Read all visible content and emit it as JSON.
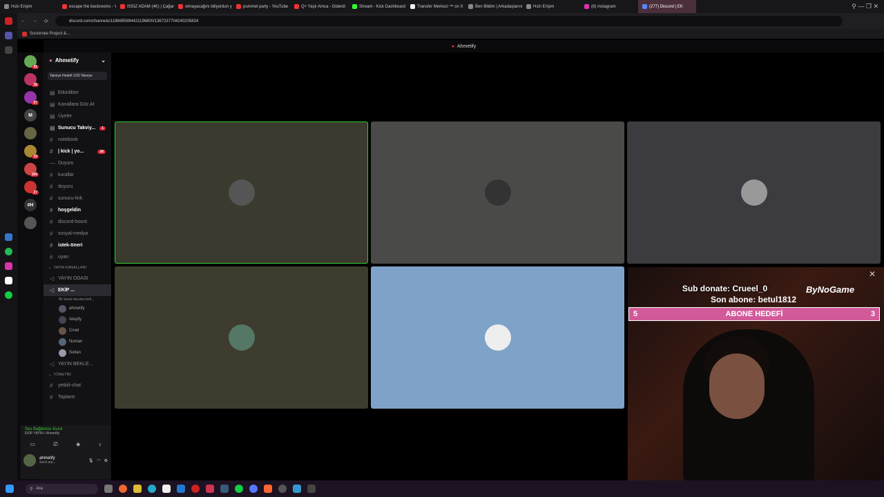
{
  "browser": {
    "tabs": [
      {
        "label": "Hızlı Erişim",
        "color": "#888"
      },
      {
        "label": "escape the backrooms - Y",
        "color": "#e33"
      },
      {
        "label": "ISSIZ ADAM (4K) | Çağan",
        "color": "#e33"
      },
      {
        "label": "olmayacağını biliyordun y",
        "color": "#e33"
      },
      {
        "label": "pummel party - YouTube",
        "color": "#e33"
      },
      {
        "label": "Q+ Yaşlı Amca - Giderdi",
        "color": "#e33"
      },
      {
        "label": "Stream - Kick Dashboard",
        "color": "#3f3"
      },
      {
        "label": "Transfer Merkezi ™ on X",
        "color": "#eee"
      },
      {
        "label": "Ben Bildim | Arkadaşlarını",
        "color": "#888"
      },
      {
        "label": "Hızlı Erişim",
        "color": "#888"
      },
      {
        "label": "(8) Instagram",
        "color": "#d3a"
      },
      {
        "label": "(277) Discord | EK",
        "color": "#58f",
        "active": true
      }
    ],
    "url": "discord.com/channels/1198695694421196800/1367237704240205834",
    "bookmark": "Sunstroke Project &..."
  },
  "discord": {
    "title": "Ahmetify",
    "server_name": "Ahmetify",
    "boost_label": "Takviye Hedefi 1/20 Takviye",
    "top_items": [
      {
        "label": "Etkinlikler"
      },
      {
        "label": "Kanallara Göz At"
      },
      {
        "label": "Üyeler"
      },
      {
        "label": "Sunucu Takviy...",
        "badge": "1",
        "bold": true
      }
    ],
    "channels_a": [
      {
        "label": "notebook",
        "prefix": "#"
      },
      {
        "label": "| kick | yo...",
        "prefix": "#",
        "badge": "26",
        "bold": true
      },
      {
        "label": "Duyuru",
        "prefix": "—"
      },
      {
        "label": "kurallar",
        "prefix": "#"
      },
      {
        "label": "duyuru",
        "prefix": "#"
      },
      {
        "label": "sunucu-link",
        "prefix": "#"
      },
      {
        "label": "hoşgeldin",
        "prefix": "#",
        "bold": true
      },
      {
        "label": "discord-boost",
        "prefix": "#"
      },
      {
        "label": "sosyal-medya",
        "prefix": "#"
      },
      {
        "label": "istek-öneri",
        "prefix": "#",
        "bold": true
      },
      {
        "label": "uyarı",
        "prefix": "#"
      }
    ],
    "cat_stream": "YAYIN KANALLARI",
    "yayin_odasi": "YAYIN ODASI",
    "ekip": "EKİP ...",
    "ekip_sub": "Bir kanal durumu beli...",
    "users": [
      {
        "name": "ahmetify",
        "color": "#556"
      },
      {
        "name": "Ateşify",
        "color": "#445"
      },
      {
        "name": "Cruel",
        "color": "#654"
      },
      {
        "name": "Numan",
        "color": "#567"
      },
      {
        "name": "Sultan",
        "color": "#99a"
      }
    ],
    "yayin_bekle": "YAYIN BEKLE...",
    "cat_manage": "YÖNETİM",
    "manage_channels": [
      {
        "label": "yetkili-chat"
      },
      {
        "label": "Toplantı"
      }
    ],
    "voice_status": "Ses Bağlantısı Kurul",
    "voice_channel": "EKİP YAYIN / Ahmetify",
    "me_name": "ahmetify",
    "me_status": "Sesli ara..."
  },
  "guild_badges": [
    "41",
    "16",
    "27",
    "",
    "",
    "10",
    "160",
    "27"
  ],
  "guild_colors": [
    "#6a5",
    "#b36",
    "#93a",
    "#444",
    "#664",
    "#a83",
    "#c44",
    "#c33",
    "#333",
    "#555"
  ],
  "guild_labels": [
    "",
    "",
    "",
    "M",
    "",
    "",
    "",
    "",
    "#H",
    ""
  ],
  "stream_overlay": {
    "sub_donate": "Sub donate: Crueel_0",
    "brand": "ByNoGame",
    "last_sub": "Son abone: betul1812",
    "goal_left": "5",
    "goal_label": "ABONE HEDEFİ",
    "goal_right": "3"
  },
  "taskbar": {
    "search": "Ara"
  }
}
